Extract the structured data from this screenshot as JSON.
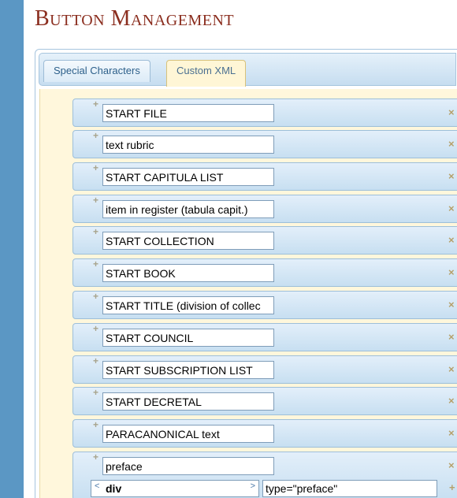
{
  "page": {
    "title": "Button Management"
  },
  "tabs": [
    {
      "label": "Special Characters",
      "active": false
    },
    {
      "label": "Custom XML",
      "active": true
    }
  ],
  "icons": {
    "add": "+",
    "delete": "×",
    "arrow_left": "<",
    "arrow_right": ">"
  },
  "colors": {
    "title": "#8b2e1f",
    "left_bar": "#5b97c4",
    "row_bg": "#cfe3f3",
    "tab_body": "#fff7dc"
  },
  "buttons": [
    {
      "label": "START FILE"
    },
    {
      "label": "text rubric"
    },
    {
      "label": "START CAPITULA LIST"
    },
    {
      "label": "item in register (tabula capit.)"
    },
    {
      "label": "START COLLECTION"
    },
    {
      "label": "START BOOK"
    },
    {
      "label": "START TITLE (division of collec"
    },
    {
      "label": "START COUNCIL"
    },
    {
      "label": "START SUBSCRIPTION LIST"
    },
    {
      "label": "START DECRETAL"
    },
    {
      "label": "PARACANONICAL text"
    },
    {
      "label": "preface",
      "tag": "div",
      "attributes": "type=\"preface\""
    }
  ]
}
